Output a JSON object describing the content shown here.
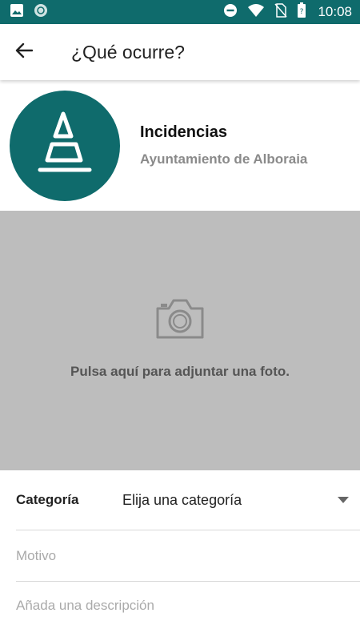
{
  "status_bar": {
    "time": "10:08",
    "icons": [
      "image-icon",
      "circle-app-icon",
      "do-not-disturb-icon",
      "wifi-icon",
      "no-sim-icon",
      "battery-icon"
    ],
    "background": "#0f6b6c"
  },
  "app_bar": {
    "title": "¿Qué ocurre?",
    "back_icon": "arrow-left-icon"
  },
  "header": {
    "title": "Incidencias",
    "subtitle": "Ayuntamiento de Alboraia",
    "logo_color": "#0f6b6c"
  },
  "photo": {
    "icon": "camera-icon",
    "prompt": "Pulsa aquí para adjuntar una foto.",
    "background": "#bdbdbd"
  },
  "form": {
    "category_label": "Categoría",
    "category_value": "Elija una categoría",
    "motivo_placeholder": "Motivo",
    "description_placeholder": "Añada una descripción"
  }
}
